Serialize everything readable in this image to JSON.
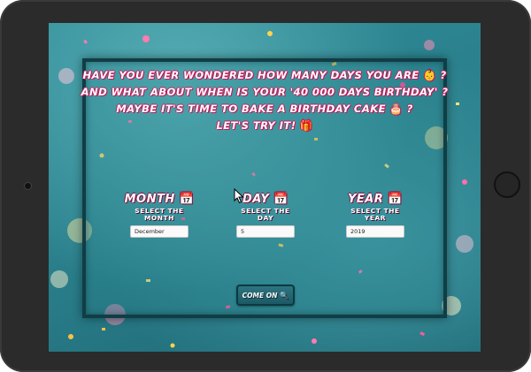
{
  "headline": {
    "line1": "HAVE YOU EVER WONDERED HOW MANY DAYS YOU ARE",
    "line1_emoji": "👶",
    "line1_end": " ?",
    "line2": "AND WHAT ABOUT WHEN IS YOUR '40 000 DAYS BIRTHDAY' ?",
    "line3": "MAYBE IT'S TIME TO BAKE A BIRTHDAY CAKE",
    "line3_emoji": "🎂",
    "line3_end": " ?",
    "line4": "LET'S TRY IT!",
    "line4_emoji": "🎁"
  },
  "form": {
    "month": {
      "title": "MONTH",
      "icon": "📅",
      "subtitle_line1": "SELECT THE",
      "subtitle_line2": "MONTH",
      "value": "December"
    },
    "day": {
      "title": "DAY",
      "icon": "📅",
      "subtitle_line1": "SELECT THE",
      "subtitle_line2": "DAY",
      "value": "5"
    },
    "year": {
      "title": "YEAR",
      "icon": "📅",
      "subtitle_line1": "SELECT THE",
      "subtitle_line2": "YEAR",
      "value": "2019"
    },
    "submit": {
      "label": "COME ON",
      "icon": "🔍"
    }
  },
  "colors": {
    "background_teal": "#2f8c98",
    "card_border": "#103e46",
    "text_outline_pink": "#c2185b",
    "button_teal": "#1c5a65"
  }
}
